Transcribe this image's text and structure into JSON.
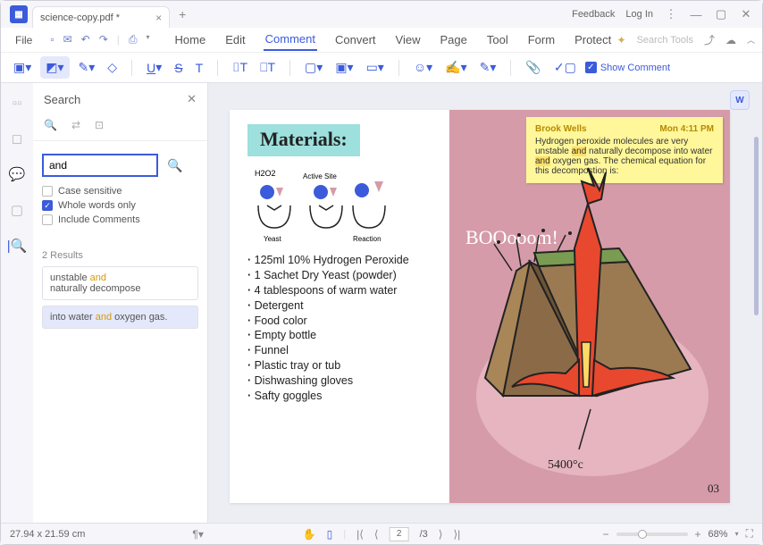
{
  "title": {
    "filename": "science-copy.pdf *",
    "feedback": "Feedback",
    "login": "Log In"
  },
  "menu": {
    "file": "File",
    "tabs": [
      "Home",
      "Edit",
      "Comment",
      "Convert",
      "View",
      "Page",
      "Tool",
      "Form",
      "Protect"
    ],
    "active": "Comment",
    "searchTools": "Search Tools"
  },
  "ribbon": {
    "underline": "U",
    "strike": "S",
    "text": "T",
    "showComment": "Show Comment"
  },
  "search": {
    "title": "Search",
    "input": "and",
    "opts": {
      "caseSensitive": "Case sensitive",
      "wholeWords": "Whole words only",
      "includeComments": "Include Comments"
    },
    "resultsLabel": "2 Results",
    "results": [
      {
        "pre": "unstable ",
        "hl": "and",
        "post1": "",
        "line2pre": "naturally decompose",
        "line2hl": "",
        "line2post": ""
      },
      {
        "pre": "into water ",
        "hl": "and",
        "post1": " oxygen gas.",
        "line2pre": "",
        "line2hl": "",
        "line2post": ""
      }
    ]
  },
  "doc": {
    "materialsTitle": "Materials:",
    "diagram": {
      "h2o2": "H2O2",
      "activeSite": "Active Site",
      "yeast": "Yeast",
      "reaction": "Reaction"
    },
    "bullets": [
      "125ml 10% Hydrogen Peroxide",
      "1 Sachet Dry Yeast (powder)",
      "4 tablespoons of warm water",
      "Detergent",
      "Food color",
      "Empty bottle",
      "Funnel",
      "Plastic tray or tub",
      "Dishwashing gloves",
      "Safty goggles"
    ],
    "note": {
      "author": "Brook Wells",
      "time": "Mon 4:11 PM",
      "t1a": "Hydrogen peroxide molecules are very unstable ",
      "t1hl": "and",
      "t2a": " naturally decompose into water ",
      "t2hl": "and",
      "t2b": " oxygen gas. The chemical equation for this decompostion is:"
    },
    "boom": "BOOooom!",
    "temp": "5400°c",
    "pagenum": "03"
  },
  "status": {
    "dims": "27.94 x 21.59 cm",
    "pages": "/3",
    "pagenow": "2",
    "zoom": "68%"
  }
}
